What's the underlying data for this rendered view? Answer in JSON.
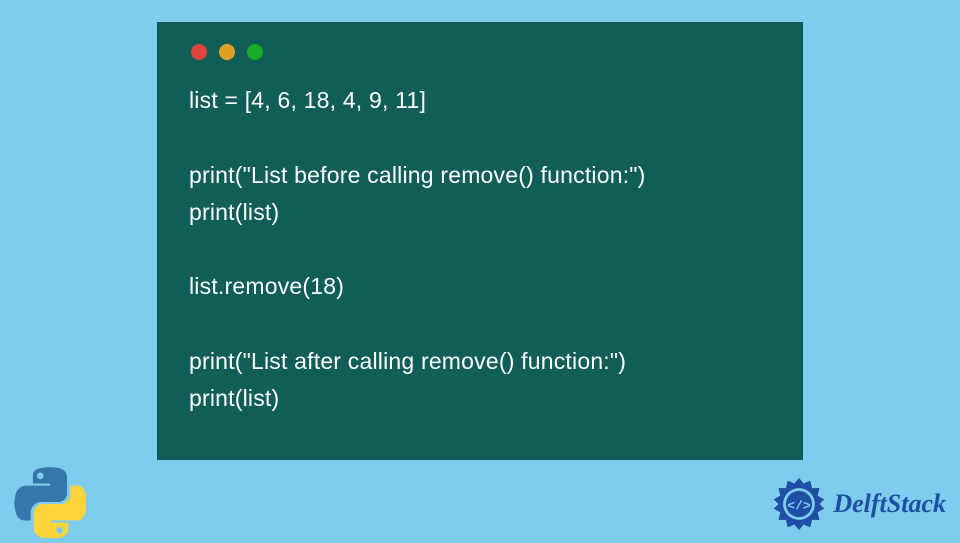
{
  "code": {
    "lines": [
      "list = [4, 6, 18, 4, 9, 11]",
      "",
      "print(\"List before calling remove() function:\")",
      "print(list)",
      "",
      "list.remove(18)",
      "",
      "print(\"List after calling remove() function:\")",
      "print(list)"
    ]
  },
  "branding": {
    "site_name": "DelftStack"
  },
  "colors": {
    "background": "#7fcdee",
    "code_bg": "#115e59",
    "code_text": "#ffffff",
    "brand_blue": "#1e4fa3"
  }
}
